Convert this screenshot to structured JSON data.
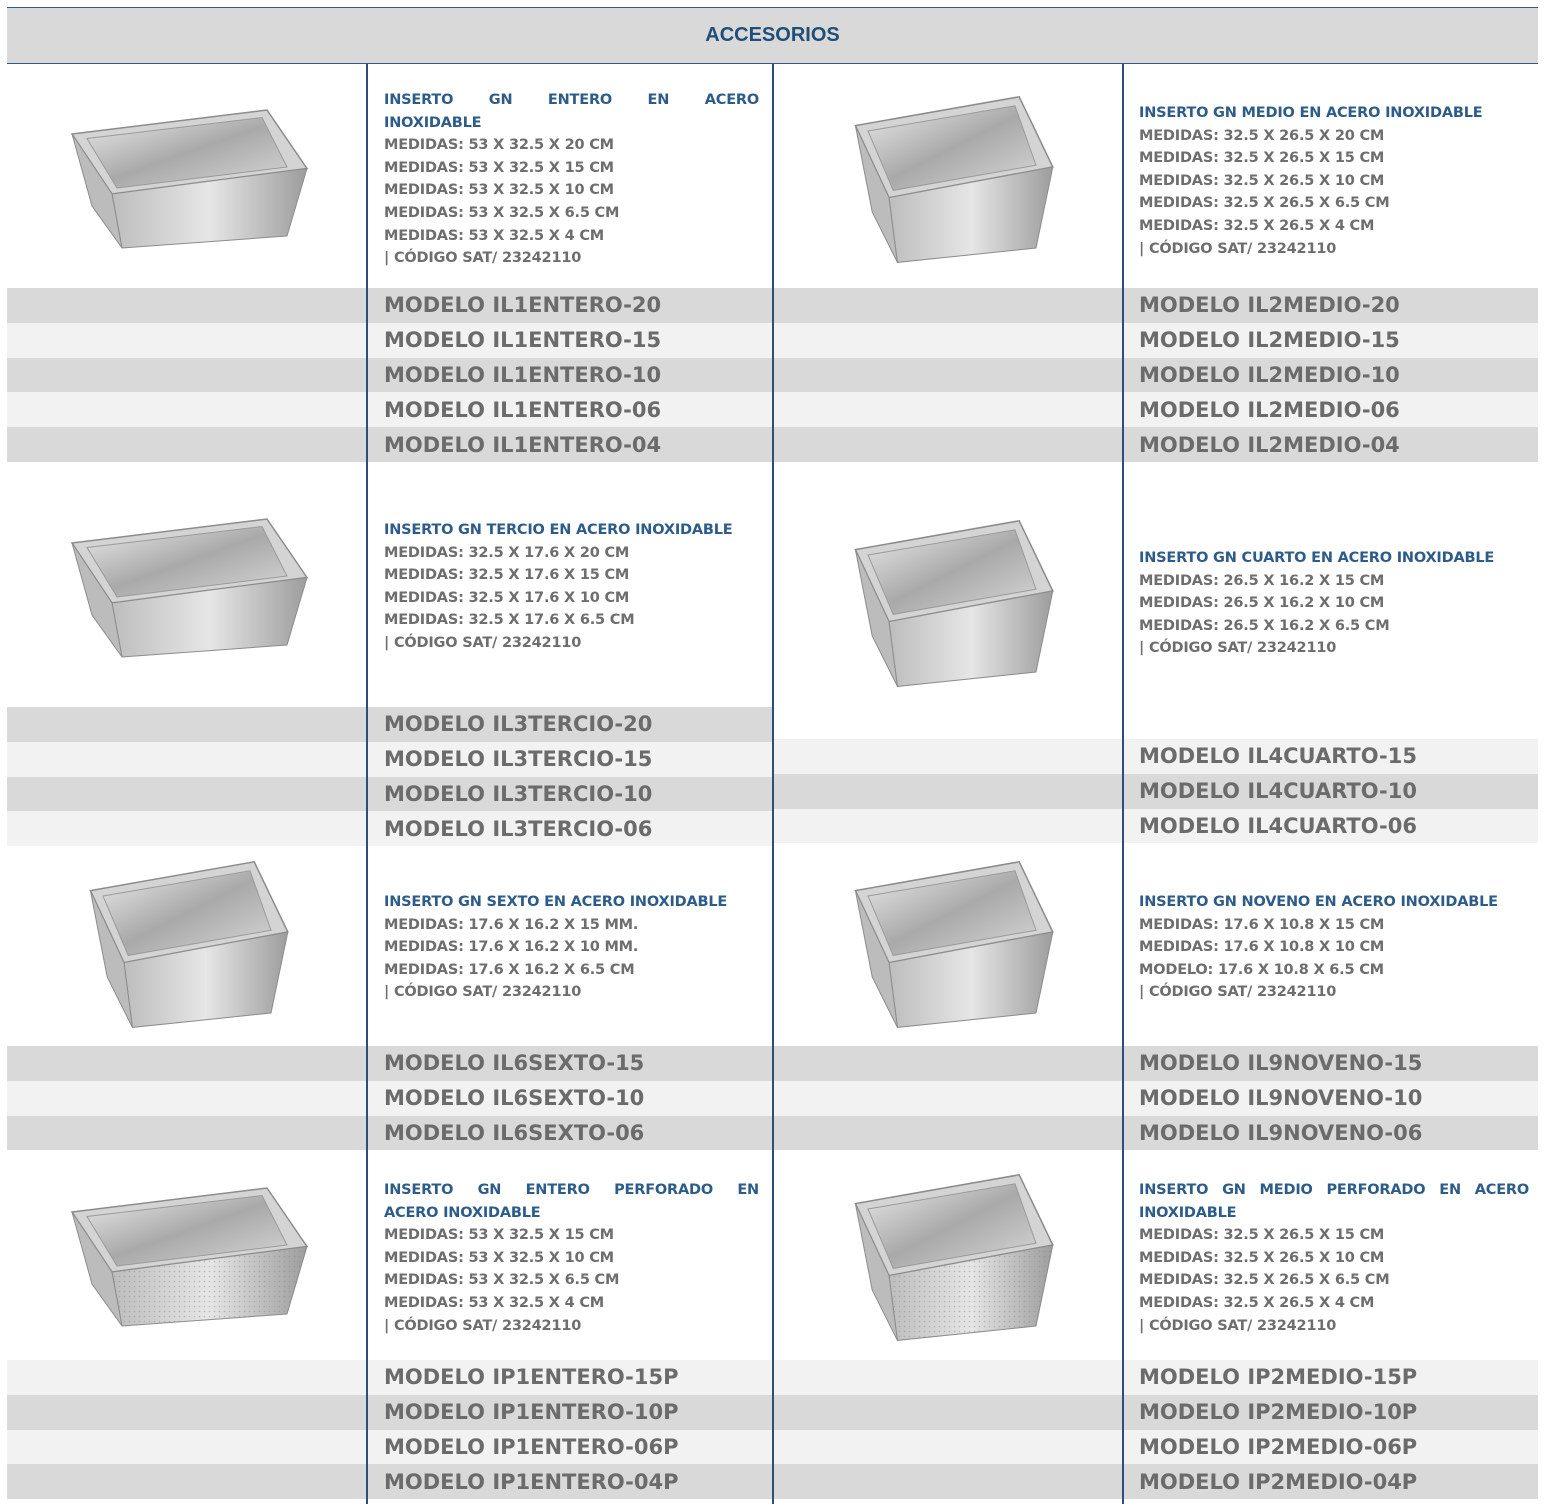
{
  "header": {
    "title": "ACCESORIOS"
  },
  "products": [
    {
      "title": "INSERTO GN ENTERO EN ACERO INOXIDABLE",
      "title_lines": [
        "INSERTO GN ENTERO EN ACERO",
        "INOXIDABLE"
      ],
      "specs": [
        "MEDIDAS: 53 X 32.5 X 20 CM",
        "MEDIDAS: 53 X 32.5 X 15 CM",
        "MEDIDAS: 53 X 32.5 X 10 CM",
        "MEDIDAS: 53 X 32.5 X 6.5 CM",
        "MEDIDAS: 53 X 32.5 X 4 CM",
        "| CÓDIGO SAT/ 23242110"
      ],
      "models": [
        "MODELO IL1ENTERO-20",
        "MODELO IL1ENTERO-15",
        "MODELO IL1ENTERO-10",
        "MODELO IL1ENTERO-06",
        "MODELO IL1ENTERO-04"
      ],
      "image": "steel-pan-full"
    },
    {
      "title": "INSERTO GN MEDIO EN ACERO INOXIDABLE",
      "title_lines": [
        "INSERTO GN MEDIO EN ACERO INOXIDABLE"
      ],
      "specs": [
        "MEDIDAS: 32.5 X 26.5 X 20 CM",
        "MEDIDAS: 32.5 X 26.5 X 15 CM",
        "MEDIDAS: 32.5 X 26.5 X 10 CM",
        "MEDIDAS: 32.5 X 26.5 X 6.5 CM",
        "MEDIDAS: 32.5 X 26.5 X 4 CM",
        "| CÓDIGO SAT/ 23242110"
      ],
      "models": [
        "MODELO IL2MEDIO-20",
        "MODELO IL2MEDIO-15",
        "MODELO IL2MEDIO-10",
        "MODELO IL2MEDIO-06",
        "MODELO IL2MEDIO-04"
      ],
      "image": "steel-pan-half"
    },
    {
      "title": "INSERTO GN TERCIO EN ACERO INOXIDABLE",
      "title_lines": [
        "INSERTO GN TERCIO EN ACERO INOXIDABLE"
      ],
      "specs": [
        "MEDIDAS: 32.5 X 17.6 X 20 CM",
        "MEDIDAS: 32.5 X 17.6 X 15 CM",
        "MEDIDAS: 32.5 X 17.6 X 10 CM",
        "MEDIDAS: 32.5 X 17.6 X 6.5 CM",
        "| CÓDIGO SAT/ 23242110"
      ],
      "models": [
        "MODELO IL3TERCIO-20",
        "MODELO IL3TERCIO-15",
        "MODELO IL3TERCIO-10",
        "MODELO IL3TERCIO-06"
      ],
      "image": "steel-pan-third"
    },
    {
      "title": "INSERTO GN CUARTO EN ACERO INOXIDABLE",
      "title_lines": [
        "INSERTO GN CUARTO EN ACERO INOXIDABLE"
      ],
      "specs": [
        "MEDIDAS: 26.5 X 16.2 X 15 CM",
        "MEDIDAS: 26.5 X 16.2 X 10 CM",
        "MEDIDAS: 26.5 X 16.2 X 6.5 CM",
        "| CÓDIGO SAT/ 23242110"
      ],
      "models": [
        "MODELO IL4CUARTO-15",
        "MODELO IL4CUARTO-10",
        "MODELO IL4CUARTO-06"
      ],
      "image": "steel-pan-quarter"
    },
    {
      "title": "INSERTO GN SEXTO EN ACERO INOXIDABLE",
      "title_lines": [
        "INSERTO GN SEXTO EN ACERO INOXIDABLE"
      ],
      "specs": [
        "MEDIDAS: 17.6 X 16.2 X 15 MM.",
        "MEDIDAS: 17.6 X 16.2 X 10 MM.",
        "MEDIDAS: 17.6 X 16.2 X 6.5 CM",
        "| CÓDIGO SAT/ 23242110"
      ],
      "models": [
        "MODELO IL6SEXTO-15",
        "MODELO IL6SEXTO-10",
        "MODELO IL6SEXTO-06"
      ],
      "image": "steel-pan-sixth"
    },
    {
      "title": "INSERTO GN NOVENO EN ACERO INOXIDABLE",
      "title_lines": [
        "INSERTO GN NOVENO EN ACERO INOXIDABLE"
      ],
      "specs": [
        "MEDIDAS: 17.6 X 10.8 X 15 CM",
        "MEDIDAS: 17.6 X 10.8 X 10 CM",
        "MODELO: 17.6 X 10.8 X 6.5 CM",
        "| CÓDIGO SAT/ 23242110"
      ],
      "models": [
        "MODELO IL9NOVENO-15",
        "MODELO IL9NOVENO-10",
        "MODELO IL9NOVENO-06"
      ],
      "image": "steel-pan-ninth"
    },
    {
      "title": "INSERTO GN ENTERO PERFORADO EN ACERO INOXIDABLE",
      "title_lines": [
        "INSERTO GN ENTERO PERFORADO EN",
        "ACERO INOXIDABLE"
      ],
      "specs": [
        "MEDIDAS: 53 X 32.5 X 15 CM",
        "MEDIDAS: 53 X 32.5 X 10 CM",
        "MEDIDAS: 53 X 32.5 X 6.5 CM",
        "MEDIDAS: 53 X 32.5 X 4 CM",
        "| CÓDIGO SAT/ 23242110"
      ],
      "models": [
        "MODELO IP1ENTERO-15P",
        "MODELO IP1ENTERO-10P",
        "MODELO IP1ENTERO-06P",
        "MODELO IP1ENTERO-04P"
      ],
      "image": "perforated-pan-full"
    },
    {
      "title": "INSERTO GN MEDIO PERFORADO EN ACERO INOXIDABLE",
      "title_lines": [
        "INSERTO GN MEDIO PERFORADO EN ACERO",
        "INOXIDABLE"
      ],
      "specs": [
        "MEDIDAS: 32.5 X 26.5 X 15 CM",
        "MEDIDAS: 32.5 X 26.5 X 10 CM",
        "MEDIDAS: 32.5 X 26.5 X 6.5 CM",
        "MEDIDAS: 32.5 X 26.5 X 4 CM",
        "| CÓDIGO SAT/ 23242110"
      ],
      "models": [
        "MODELO IP2MEDIO-15P",
        "MODELO IP2MEDIO-10P",
        "MODELO IP2MEDIO-06P",
        "MODELO IP2MEDIO-04P"
      ],
      "image": "perforated-pan-half"
    }
  ]
}
